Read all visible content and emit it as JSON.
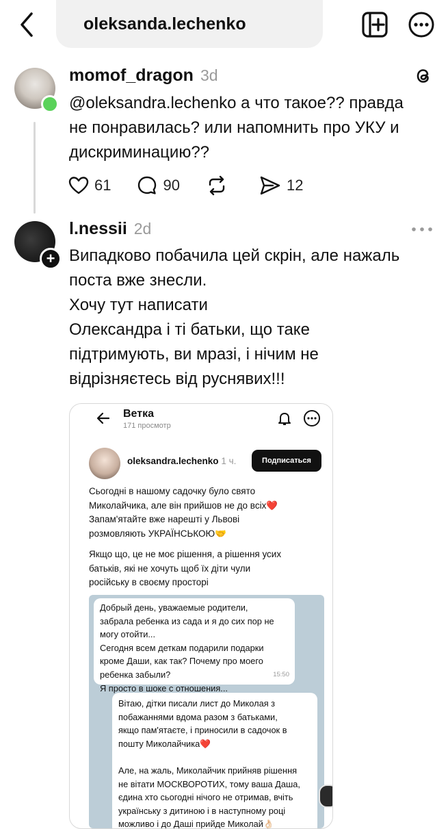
{
  "header": {
    "search_value": "oleksanda.lechenko",
    "icons": {
      "back": "chevron-left-icon",
      "new_post": "new-post-icon",
      "more": "more-horizontal-icon"
    }
  },
  "reply1": {
    "username": "momof_dragon",
    "time": "3d",
    "text_lines": [
      "@oleksandra.lechenko а что такое?? правда",
      "не понравилась? или напомнить про УКУ и",
      "дискриминацию??"
    ],
    "likes": "61",
    "comments": "90",
    "shares": "12"
  },
  "reply2": {
    "username": "l.nessii",
    "time": "2d",
    "text_lines": [
      "Випадково побачила цей скрін, але нажаль",
      "поста вже знесли.",
      "Хочу тут написати",
      "Олександра і ті батьки, що таке",
      "підтримують, ви мразі, і нічим не",
      "відрізняєтесь від руснявих!!!"
    ]
  },
  "screenshot": {
    "title": "Ветка",
    "views": "171 просмотр",
    "username": "oleksandra.lechenko",
    "time": "1 ч.",
    "subscribe": "Подписаться",
    "post_lines": [
      "Сьогодні в нашому садочку було свято",
      "Миколайчика, але він прийшов не до всіх❤️",
      "Запам'ятайте вже нарешті у Львові",
      "розмовляють УКРАЇНСЬКОЮ🤝"
    ],
    "post_lines2": [
      "Якщо що, це не моє рішення, а рішення усих",
      "батьків, які не хочуть щоб їх діти чули",
      "російську в своєму просторі"
    ],
    "msg1_lines": [
      "Добрый день, уважаемые родители,",
      "забрала ребенка из сада и я до сих пор не",
      "могу отойти...",
      "Сегодня всем деткам подарили подарки",
      "кроме Даши, как так? Почему про моего",
      "ребенка забыли?",
      "Я просто в шоке с отношения..."
    ],
    "msg1_time": "15:50",
    "msg2_lines": [
      "Вітаю, дітки писали лист до Миколая з",
      "побажаннями вдома разом з батьками,",
      "якщо пам'ятаєте, і приносили в садочок в",
      "пошту Миколайчика❤️",
      "",
      "Але, на жаль, Миколайчик прийняв рішення",
      "не вітати МОСКВОРОТИХ, тому ваша Даша,",
      "єдина хто сьогодні нічого не отримав, вчіть",
      "українську з дитиною і в наступному році",
      "можливо і до Даші прийде Миколай👌🏻"
    ]
  }
}
